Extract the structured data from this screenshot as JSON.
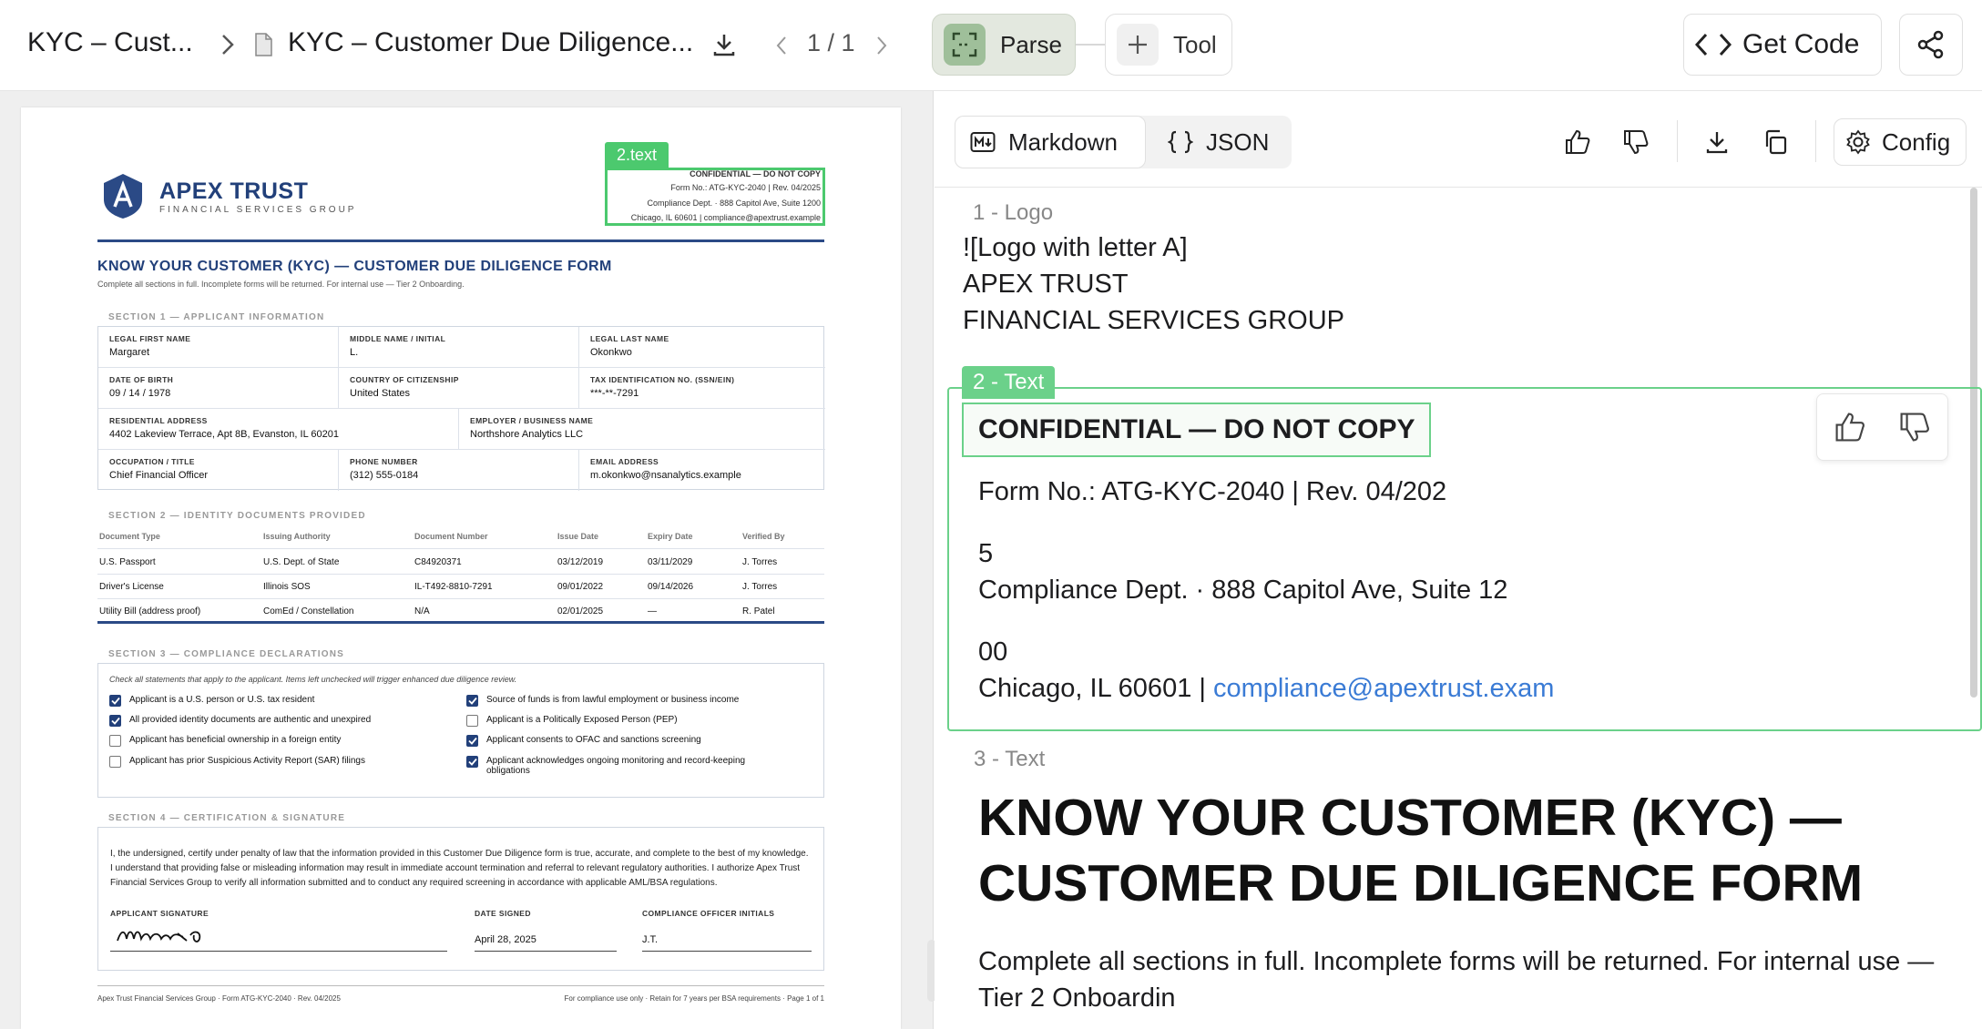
{
  "topbar": {
    "breadcrumb_root": "KYC – Cust...",
    "doc_name": "KYC – Customer Due Diligence...",
    "page_indicator": "1 / 1",
    "parse_label": "Parse",
    "tool_label": "Tool",
    "get_code_label": "Get Code"
  },
  "document": {
    "brand": "APEX TRUST",
    "brand_sub": "FINANCIAL SERVICES GROUP",
    "box_tag": "2.text",
    "header_lines": [
      "CONFIDENTIAL — DO NOT COPY",
      "Form No.: ATG-KYC-2040 | Rev. 04/2025",
      "Compliance Dept. · 888 Capitol Ave, Suite 1200",
      "Chicago, IL 60601 | compliance@apextrust.example"
    ],
    "title": "KNOW YOUR CUSTOMER (KYC) — CUSTOMER DUE DILIGENCE FORM",
    "subtitle": "Complete all sections in full. Incomplete forms will be returned. For internal use — Tier 2 Onboarding.",
    "section1_label": "SECTION 1 — APPLICANT INFORMATION",
    "section1": {
      "first_name_k": "LEGAL FIRST NAME",
      "first_name_v": "Margaret",
      "middle_k": "MIDDLE NAME / INITIAL",
      "middle_v": "L.",
      "last_k": "LEGAL LAST NAME",
      "last_v": "Okonkwo",
      "dob_k": "DATE OF BIRTH",
      "dob_v": "09 / 14 / 1978",
      "citizenship_k": "COUNTRY OF CITIZENSHIP",
      "citizenship_v": "United States",
      "tin_k": "TAX IDENTIFICATION NO. (SSN/EIN)",
      "tin_v": "***-**-7291",
      "address_k": "RESIDENTIAL ADDRESS",
      "address_v": "4402 Lakeview Terrace, Apt 8B, Evanston, IL 60201",
      "employer_k": "EMPLOYER / BUSINESS NAME",
      "employer_v": "Northshore Analytics LLC",
      "occupation_k": "OCCUPATION / TITLE",
      "occupation_v": "Chief Financial Officer",
      "phone_k": "PHONE NUMBER",
      "phone_v": "(312) 555-0184",
      "email_k": "EMAIL ADDRESS",
      "email_v": "m.okonkwo@nsanalytics.example"
    },
    "section2_label": "SECTION 2 — IDENTITY DOCUMENTS PROVIDED",
    "section2_headers": [
      "Document Type",
      "Issuing Authority",
      "Document Number",
      "Issue Date",
      "Expiry Date",
      "Verified By"
    ],
    "section2_rows": [
      [
        "U.S. Passport",
        "U.S. Dept. of State",
        "C84920371",
        "03/12/2019",
        "03/11/2029",
        "J. Torres"
      ],
      [
        "Driver's License",
        "Illinois SOS",
        "IL-T492-8810-7291",
        "09/01/2022",
        "09/14/2026",
        "J. Torres"
      ],
      [
        "Utility Bill (address proof)",
        "ComEd / Constellation",
        "N/A",
        "02/01/2025",
        "—",
        "R. Patel"
      ]
    ],
    "section3_label": "SECTION 3 — COMPLIANCE DECLARATIONS",
    "section3_note": "Check all statements that apply to the applicant. Items left unchecked will trigger enhanced due diligence review.",
    "section3_left": [
      {
        "text": "Applicant is a U.S. person or U.S. tax resident",
        "checked": true
      },
      {
        "text": "All provided identity documents are authentic and unexpired",
        "checked": true
      },
      {
        "text": "Applicant has beneficial ownership in a foreign entity",
        "checked": false
      },
      {
        "text": "Applicant has prior Suspicious Activity Report (SAR) filings",
        "checked": false
      }
    ],
    "section3_right": [
      {
        "text": "Source of funds is from lawful employment or business income",
        "checked": true
      },
      {
        "text": "Applicant is a Politically Exposed Person (PEP)",
        "checked": false
      },
      {
        "text": "Applicant consents to OFAC and sanctions screening",
        "checked": true
      },
      {
        "text": "Applicant acknowledges ongoing monitoring and record-keeping obligations",
        "checked": true
      }
    ],
    "section4_label": "SECTION 4 — CERTIFICATION & SIGNATURE",
    "certification": "I, the undersigned, certify under penalty of law that the information provided in this Customer Due Diligence form is true, accurate, and complete to the best of my knowledge. I understand that providing false or misleading information may result in immediate account termination and referral to relevant regulatory authorities. I authorize Apex Trust Financial Services Group to verify all information submitted and to conduct any required screening in accordance with applicable AML/BSA regulations.",
    "sig_k": "APPLICANT SIGNATURE",
    "date_k": "DATE SIGNED",
    "date_v": "April 28, 2025",
    "initials_k": "COMPLIANCE OFFICER INITIALS",
    "initials_v": "J.T.",
    "footer_left": "Apex Trust Financial Services Group  ·  Form ATG-KYC-2040  ·  Rev. 04/2025",
    "footer_right": "For compliance use only  ·  Retain for 7 years per BSA requirements  ·  Page 1 of 1"
  },
  "output": {
    "tab_markdown": "Markdown",
    "tab_json": "JSON",
    "config_label": "Config",
    "block1_label": "1 - Logo",
    "block1_lines": [
      "![Logo with letter A]",
      "APEX TRUST",
      "FINANCIAL SERVICES GROUP"
    ],
    "block2_label": "2 - Text",
    "block2_heading": "CONFIDENTIAL — DO NOT COPY",
    "block2_form": "Form No.: ATG-KYC-2040 | Rev. 04/202",
    "block2_five": "5",
    "block2_dept": "Compliance Dept. · 888 Capitol Ave, Suite 12",
    "block2_zeros": "00",
    "block2_city": "Chicago, IL 60601 | ",
    "block2_email": "compliance@apextrust.exam",
    "block3_label": "3 - Text",
    "block3_heading": "KNOW YOUR CUSTOMER (KYC) — CUSTOMER DUE DILIGENCE FORM",
    "block3_para": "Complete all sections in full. Incomplete forms will be returned. For internal use — Tier 2 Onboardin"
  }
}
